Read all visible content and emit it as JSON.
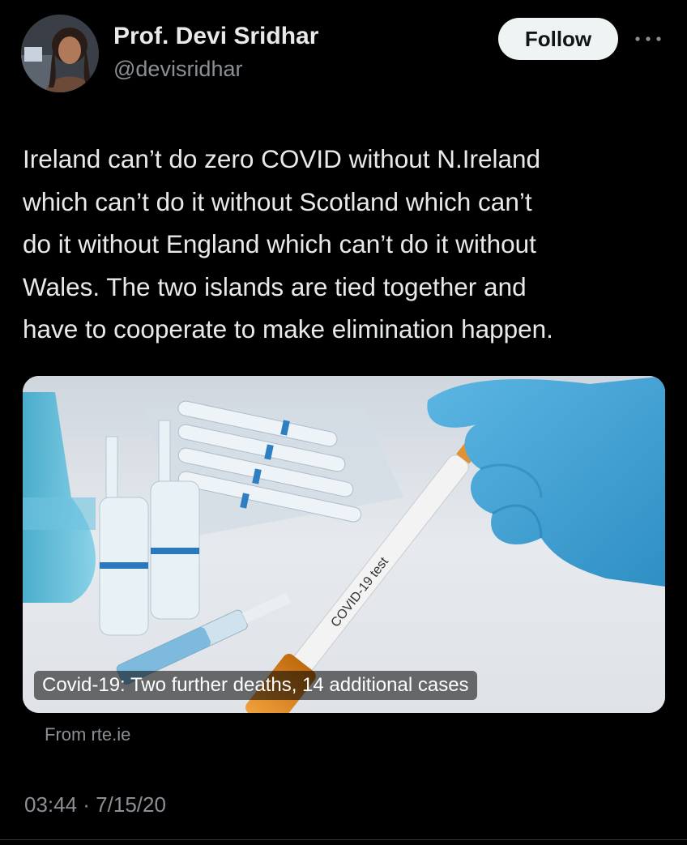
{
  "author": {
    "name": "Prof. Devi Sridhar",
    "handle": "@devisridhar"
  },
  "follow_label": "Follow",
  "tweet": {
    "text": "Ireland can’t do zero COVID without N.Ireland\nwhich can’t do it without Scotland which can’t\ndo it without England which can’t do it without\nWales. The two islands are tied together and\nhave to cooperate to make elimination happen."
  },
  "link_card": {
    "caption": "Covid-19: Two further deaths, 14 additional cases",
    "image_text": "COVID-19 test",
    "source": "From rte.ie"
  },
  "timestamp": "03:44 · 7/15/20",
  "colors": {
    "background": "#000000",
    "text": "#e7e9ea",
    "muted": "#8b9096",
    "follow_bg": "#eff3f4",
    "glove": "#4aa8d8",
    "cap": "#e08a1e"
  },
  "icons": {
    "more": "more-horizontal-icon"
  }
}
